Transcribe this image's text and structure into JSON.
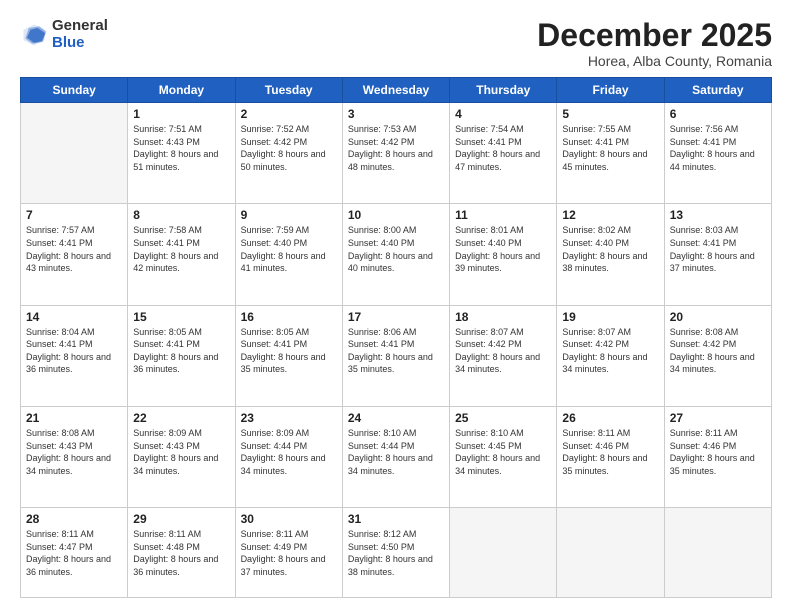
{
  "logo": {
    "general": "General",
    "blue": "Blue"
  },
  "header": {
    "month": "December 2025",
    "location": "Horea, Alba County, Romania"
  },
  "weekdays": [
    "Sunday",
    "Monday",
    "Tuesday",
    "Wednesday",
    "Thursday",
    "Friday",
    "Saturday"
  ],
  "weeks": [
    [
      {
        "day": "",
        "sunrise": "",
        "sunset": "",
        "daylight": ""
      },
      {
        "day": "1",
        "sunrise": "Sunrise: 7:51 AM",
        "sunset": "Sunset: 4:43 PM",
        "daylight": "Daylight: 8 hours and 51 minutes."
      },
      {
        "day": "2",
        "sunrise": "Sunrise: 7:52 AM",
        "sunset": "Sunset: 4:42 PM",
        "daylight": "Daylight: 8 hours and 50 minutes."
      },
      {
        "day": "3",
        "sunrise": "Sunrise: 7:53 AM",
        "sunset": "Sunset: 4:42 PM",
        "daylight": "Daylight: 8 hours and 48 minutes."
      },
      {
        "day": "4",
        "sunrise": "Sunrise: 7:54 AM",
        "sunset": "Sunset: 4:41 PM",
        "daylight": "Daylight: 8 hours and 47 minutes."
      },
      {
        "day": "5",
        "sunrise": "Sunrise: 7:55 AM",
        "sunset": "Sunset: 4:41 PM",
        "daylight": "Daylight: 8 hours and 45 minutes."
      },
      {
        "day": "6",
        "sunrise": "Sunrise: 7:56 AM",
        "sunset": "Sunset: 4:41 PM",
        "daylight": "Daylight: 8 hours and 44 minutes."
      }
    ],
    [
      {
        "day": "7",
        "sunrise": "Sunrise: 7:57 AM",
        "sunset": "Sunset: 4:41 PM",
        "daylight": "Daylight: 8 hours and 43 minutes."
      },
      {
        "day": "8",
        "sunrise": "Sunrise: 7:58 AM",
        "sunset": "Sunset: 4:41 PM",
        "daylight": "Daylight: 8 hours and 42 minutes."
      },
      {
        "day": "9",
        "sunrise": "Sunrise: 7:59 AM",
        "sunset": "Sunset: 4:40 PM",
        "daylight": "Daylight: 8 hours and 41 minutes."
      },
      {
        "day": "10",
        "sunrise": "Sunrise: 8:00 AM",
        "sunset": "Sunset: 4:40 PM",
        "daylight": "Daylight: 8 hours and 40 minutes."
      },
      {
        "day": "11",
        "sunrise": "Sunrise: 8:01 AM",
        "sunset": "Sunset: 4:40 PM",
        "daylight": "Daylight: 8 hours and 39 minutes."
      },
      {
        "day": "12",
        "sunrise": "Sunrise: 8:02 AM",
        "sunset": "Sunset: 4:40 PM",
        "daylight": "Daylight: 8 hours and 38 minutes."
      },
      {
        "day": "13",
        "sunrise": "Sunrise: 8:03 AM",
        "sunset": "Sunset: 4:41 PM",
        "daylight": "Daylight: 8 hours and 37 minutes."
      }
    ],
    [
      {
        "day": "14",
        "sunrise": "Sunrise: 8:04 AM",
        "sunset": "Sunset: 4:41 PM",
        "daylight": "Daylight: 8 hours and 36 minutes."
      },
      {
        "day": "15",
        "sunrise": "Sunrise: 8:05 AM",
        "sunset": "Sunset: 4:41 PM",
        "daylight": "Daylight: 8 hours and 36 minutes."
      },
      {
        "day": "16",
        "sunrise": "Sunrise: 8:05 AM",
        "sunset": "Sunset: 4:41 PM",
        "daylight": "Daylight: 8 hours and 35 minutes."
      },
      {
        "day": "17",
        "sunrise": "Sunrise: 8:06 AM",
        "sunset": "Sunset: 4:41 PM",
        "daylight": "Daylight: 8 hours and 35 minutes."
      },
      {
        "day": "18",
        "sunrise": "Sunrise: 8:07 AM",
        "sunset": "Sunset: 4:42 PM",
        "daylight": "Daylight: 8 hours and 34 minutes."
      },
      {
        "day": "19",
        "sunrise": "Sunrise: 8:07 AM",
        "sunset": "Sunset: 4:42 PM",
        "daylight": "Daylight: 8 hours and 34 minutes."
      },
      {
        "day": "20",
        "sunrise": "Sunrise: 8:08 AM",
        "sunset": "Sunset: 4:42 PM",
        "daylight": "Daylight: 8 hours and 34 minutes."
      }
    ],
    [
      {
        "day": "21",
        "sunrise": "Sunrise: 8:08 AM",
        "sunset": "Sunset: 4:43 PM",
        "daylight": "Daylight: 8 hours and 34 minutes."
      },
      {
        "day": "22",
        "sunrise": "Sunrise: 8:09 AM",
        "sunset": "Sunset: 4:43 PM",
        "daylight": "Daylight: 8 hours and 34 minutes."
      },
      {
        "day": "23",
        "sunrise": "Sunrise: 8:09 AM",
        "sunset": "Sunset: 4:44 PM",
        "daylight": "Daylight: 8 hours and 34 minutes."
      },
      {
        "day": "24",
        "sunrise": "Sunrise: 8:10 AM",
        "sunset": "Sunset: 4:44 PM",
        "daylight": "Daylight: 8 hours and 34 minutes."
      },
      {
        "day": "25",
        "sunrise": "Sunrise: 8:10 AM",
        "sunset": "Sunset: 4:45 PM",
        "daylight": "Daylight: 8 hours and 34 minutes."
      },
      {
        "day": "26",
        "sunrise": "Sunrise: 8:11 AM",
        "sunset": "Sunset: 4:46 PM",
        "daylight": "Daylight: 8 hours and 35 minutes."
      },
      {
        "day": "27",
        "sunrise": "Sunrise: 8:11 AM",
        "sunset": "Sunset: 4:46 PM",
        "daylight": "Daylight: 8 hours and 35 minutes."
      }
    ],
    [
      {
        "day": "28",
        "sunrise": "Sunrise: 8:11 AM",
        "sunset": "Sunset: 4:47 PM",
        "daylight": "Daylight: 8 hours and 36 minutes."
      },
      {
        "day": "29",
        "sunrise": "Sunrise: 8:11 AM",
        "sunset": "Sunset: 4:48 PM",
        "daylight": "Daylight: 8 hours and 36 minutes."
      },
      {
        "day": "30",
        "sunrise": "Sunrise: 8:11 AM",
        "sunset": "Sunset: 4:49 PM",
        "daylight": "Daylight: 8 hours and 37 minutes."
      },
      {
        "day": "31",
        "sunrise": "Sunrise: 8:12 AM",
        "sunset": "Sunset: 4:50 PM",
        "daylight": "Daylight: 8 hours and 38 minutes."
      },
      {
        "day": "",
        "sunrise": "",
        "sunset": "",
        "daylight": ""
      },
      {
        "day": "",
        "sunrise": "",
        "sunset": "",
        "daylight": ""
      },
      {
        "day": "",
        "sunrise": "",
        "sunset": "",
        "daylight": ""
      }
    ]
  ]
}
